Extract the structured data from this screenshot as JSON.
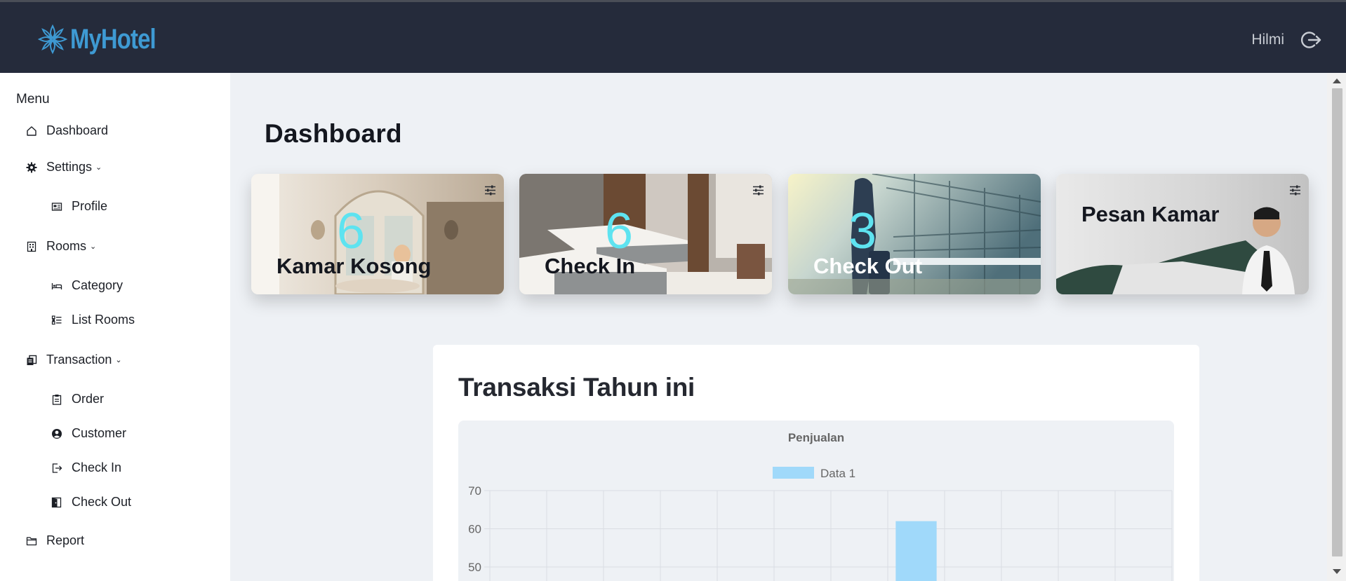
{
  "header": {
    "logo_text": "MyHotel",
    "user_name": "Hilmi",
    "logout_icon": "logout-icon"
  },
  "sidebar": {
    "title": "Menu",
    "items": [
      {
        "label": "Dashboard",
        "icon": "home-icon"
      },
      {
        "label": "Settings",
        "icon": "gear-icon",
        "expandable": true
      },
      {
        "label": "Profile",
        "icon": "id-card-icon"
      },
      {
        "label": "Rooms",
        "icon": "building-icon",
        "expandable": true
      },
      {
        "label": "Category",
        "icon": "bed-icon"
      },
      {
        "label": "List Rooms",
        "icon": "list-icon"
      },
      {
        "label": "Transaction",
        "icon": "copy-icon",
        "expandable": true
      },
      {
        "label": "Order",
        "icon": "clipboard-icon"
      },
      {
        "label": "Customer",
        "icon": "user-circle-icon"
      },
      {
        "label": "Check In",
        "icon": "sign-in-icon"
      },
      {
        "label": "Check Out",
        "icon": "door-icon"
      },
      {
        "label": "Report",
        "icon": "folder-icon"
      }
    ]
  },
  "main": {
    "title": "Dashboard",
    "cards": [
      {
        "count": "6",
        "label": "Kamar Kosong"
      },
      {
        "count": "6",
        "label": "Check In"
      },
      {
        "count": "3",
        "label": "Check Out"
      },
      {
        "count": "",
        "label": "Pesan Kamar"
      }
    ],
    "panel": {
      "title": "Transaksi Tahun ini"
    }
  },
  "colors": {
    "header_bg": "#252b3b",
    "logo": "#3e9ad3",
    "count": "#5ee3f0",
    "bar": "#a0d9fa"
  },
  "chart_data": {
    "type": "bar",
    "title": "Penjualan",
    "series": [
      {
        "name": "Data 1",
        "values": [
          null,
          null,
          null,
          null,
          null,
          null,
          null,
          62,
          null,
          null,
          null,
          null
        ]
      }
    ],
    "y_ticks": [
      70,
      60,
      50
    ],
    "ylim_visible": [
      47,
      70
    ],
    "grid": true,
    "legend": "top"
  }
}
